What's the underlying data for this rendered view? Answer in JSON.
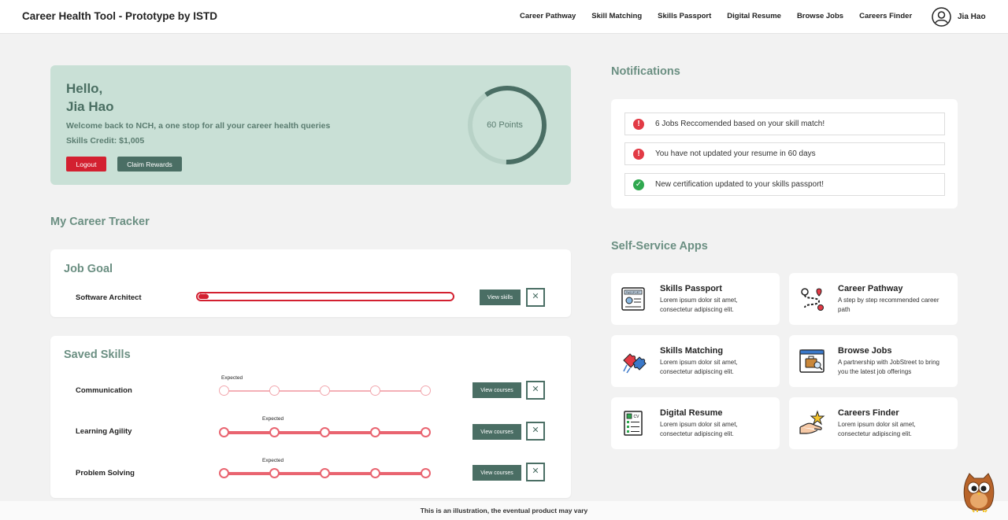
{
  "header": {
    "brand": "Career Health Tool - Prototype by ISTD",
    "nav": [
      "Career Pathway",
      "Skill Matching",
      "Skills Passport",
      "Digital Resume",
      "Browse Jobs",
      "Careers Finder"
    ],
    "user_name": "Jia Hao"
  },
  "hero": {
    "greeting": "Hello,",
    "name": "Jia Hao",
    "welcome": "Welcome back to NCH, a one stop for all your career health queries",
    "credit": "Skills Credit: $1,005",
    "logout_label": "Logout",
    "claim_label": "Claim Rewards",
    "points_label": "60 Points",
    "points_fraction": 0.6,
    "colors": {
      "bg": "#c9e0d6",
      "accent": "#4a6e64",
      "danger": "#d32030"
    }
  },
  "tracker": {
    "title": "My Career Tracker",
    "job_goal": {
      "title": "Job Goal",
      "role": "Software Architect",
      "progress_label": "4%",
      "progress_value": 0.04,
      "view_label": "View skills",
      "remove_icon": "close-icon"
    },
    "saved_skills": {
      "title": "Saved Skills",
      "expected_label": "Expected",
      "view_label": "View courses",
      "skills": [
        {
          "name": "Communication",
          "level": 0,
          "expected": 1
        },
        {
          "name": "Learning Agility",
          "level": 5,
          "expected": 2
        },
        {
          "name": "Problem Solving",
          "level": 5,
          "expected": 2
        }
      ]
    }
  },
  "notifications": {
    "title": "Notifications",
    "items": [
      {
        "icon": "alert-icon",
        "text": "6 Jobs Reccomended based on your skill match!"
      },
      {
        "icon": "alert-icon",
        "text": "You have not updated your resume in 60 days"
      },
      {
        "icon": "check-icon",
        "text": "New certification updated to your skills passport!"
      }
    ]
  },
  "apps": {
    "title": "Self-Service Apps",
    "items": [
      {
        "icon": "passport-icon",
        "title": "Skills Passport",
        "desc": "Lorem ipsum dolor sit amet, consectetur adipiscing elit."
      },
      {
        "icon": "career-pathway-icon",
        "title": "Career Pathway",
        "desc": "A step by step recommended career path"
      },
      {
        "icon": "puzzle-icon",
        "title": "Skills Matching",
        "desc": "Lorem ipsum dolor sit amet, consectetur adipiscing elit."
      },
      {
        "icon": "browse-jobs-icon",
        "title": "Browse Jobs",
        "desc": "A partnership with JobStreet to bring you the latest job offerings"
      },
      {
        "icon": "resume-icon",
        "title": "Digital Resume",
        "desc": "Lorem ipsum dolor sit amet, consectetur adipiscing elit."
      },
      {
        "icon": "careers-finder-icon",
        "title": "Careers Finder",
        "desc": "Lorem ipsum dolor sit amet, consectetur adipiscing elit."
      }
    ]
  },
  "footer": {
    "text": "This is an illustration, the eventual product may vary"
  }
}
